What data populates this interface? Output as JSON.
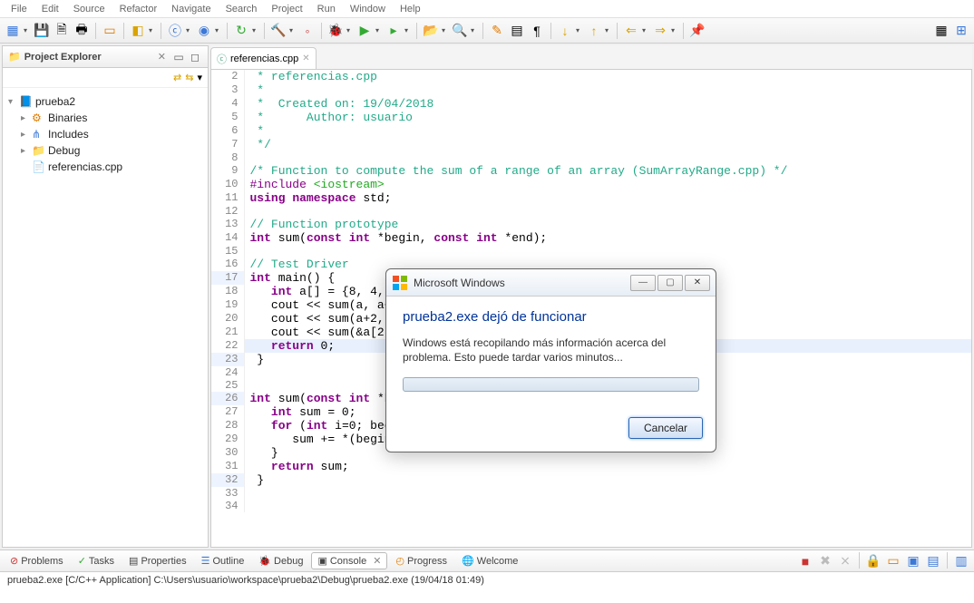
{
  "menu": [
    "File",
    "Edit",
    "Source",
    "Refactor",
    "Navigate",
    "Search",
    "Project",
    "Run",
    "Window",
    "Help"
  ],
  "project_explorer": {
    "title": "Project Explorer",
    "project": "prueba2",
    "nodes": [
      "Binaries",
      "Includes",
      "Debug",
      "referencias.cpp"
    ]
  },
  "editor_tab": {
    "filename": "referencias.cpp"
  },
  "code": {
    "l2": " * referencias.cpp",
    "l3": " *",
    "l4": " *  Created on: 19/04/2018",
    "l5": " *      Author: usuario",
    "l6": " *",
    "l7": " */",
    "l8": "",
    "l9": "/* Function to compute the sum of a range of an array (SumArrayRange.cpp) */",
    "l10a": "#include ",
    "l10b": "<iostream>",
    "l11a": "using ",
    "l11b": "namespace ",
    "l11c": "std;",
    "l12": "",
    "l13": "// Function prototype",
    "l14a": "int ",
    "l14b": "sum(",
    "l14c": "const ",
    "l14d": "int ",
    "l14e": "*begin, ",
    "l14f": "const ",
    "l14g": "int ",
    "l14h": "*end);",
    "l15": "",
    "l16": "// Test Driver",
    "l17a": "int ",
    "l17b": "main() {",
    "l18a": "   ",
    "l18b": "int ",
    "l18c": "a[] = {8, 4, 5",
    "l19": "   cout << sum(a, a+8",
    "l20": "   cout << sum(a+2, a",
    "l21": "   cout << sum(&a[2],",
    "l22a": "   ",
    "l22b": "return ",
    "l22c": "0;",
    "l23": " }",
    "l24": "",
    "l25": "",
    "l26a": "int ",
    "l26b": "sum(",
    "l26c": "const ",
    "l26d": "int ",
    "l26e": "*be",
    "l27a": "   ",
    "l27b": "int ",
    "l27c": "sum = 0;",
    "l28a": "   ",
    "l28b": "for ",
    "l28c": "(",
    "l28d": "int ",
    "l28e": "i=0; begi",
    "l29": "      sum += *(begin+",
    "l30": "   }",
    "l31a": "   ",
    "l31b": "return ",
    "l31c": "sum;",
    "l32": " }",
    "l33": "",
    "l34": ""
  },
  "bottom": {
    "tabs": [
      "Problems",
      "Tasks",
      "Properties",
      "Outline",
      "Debug",
      "Console",
      "Progress",
      "Welcome"
    ],
    "console_text": "prueba2.exe [C/C++ Application] C:\\Users\\usuario\\workspace\\prueba2\\Debug\\prueba2.exe (19/04/18 01:49)"
  },
  "dialog": {
    "window_title": "Microsoft Windows",
    "heading": "prueba2.exe dejó de funcionar",
    "message": "Windows está recopilando más información acerca del problema. Esto puede tardar varios minutos...",
    "cancel": "Cancelar"
  }
}
